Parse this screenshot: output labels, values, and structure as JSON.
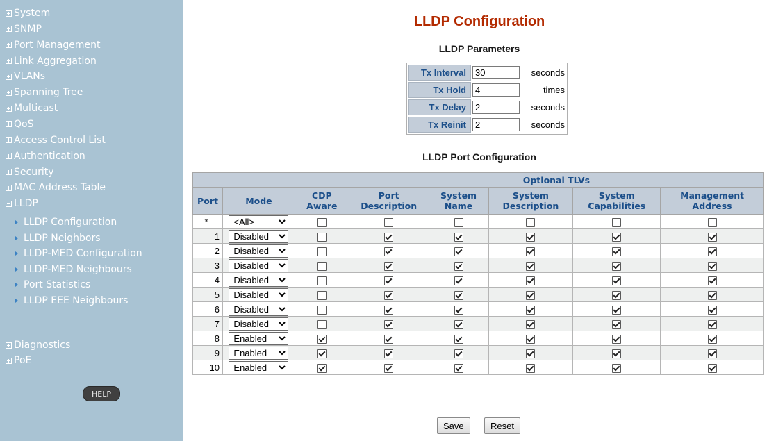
{
  "sidebar": {
    "items": [
      {
        "label": "System",
        "expand": "plus"
      },
      {
        "label": "SNMP",
        "expand": "plus"
      },
      {
        "label": "Port Management",
        "expand": "plus"
      },
      {
        "label": "Link Aggregation",
        "expand": "plus"
      },
      {
        "label": "VLANs",
        "expand": "plus"
      },
      {
        "label": "Spanning Tree",
        "expand": "plus"
      },
      {
        "label": "Multicast",
        "expand": "plus"
      },
      {
        "label": "QoS",
        "expand": "plus"
      },
      {
        "label": "Access Control List",
        "expand": "plus"
      },
      {
        "label": "Authentication",
        "expand": "plus"
      },
      {
        "label": "Security",
        "expand": "plus"
      },
      {
        "label": "MAC Address Table",
        "expand": "plus"
      },
      {
        "label": "LLDP",
        "expand": "minus"
      }
    ],
    "lldp_subitems": [
      "LLDP Configuration",
      "LLDP Neighbors",
      "LLDP-MED Configuration",
      "LLDP-MED Neighbours",
      "Port Statistics",
      "LLDP EEE Neighbours"
    ],
    "bottom_items": [
      {
        "label": "Diagnostics",
        "expand": "plus"
      },
      {
        "label": "PoE",
        "expand": "plus"
      }
    ],
    "help_label": "HELP"
  },
  "main": {
    "title": "LLDP Configuration",
    "params_title": "LLDP Parameters",
    "params": [
      {
        "label": "Tx Interval",
        "value": "30",
        "unit": "seconds"
      },
      {
        "label": "Tx Hold",
        "value": "4",
        "unit": "times"
      },
      {
        "label": "Tx Delay",
        "value": "2",
        "unit": "seconds"
      },
      {
        "label": "Tx Reinit",
        "value": "2",
        "unit": "seconds"
      }
    ],
    "port_config_title": "LLDP Port Configuration",
    "table": {
      "group_header": "Optional TLVs",
      "columns": {
        "port": "Port",
        "mode": "Mode",
        "cdp_aware": "CDP Aware",
        "port_description": "Port Description",
        "system_name": "System Name",
        "system_description": "System Description",
        "system_capabilities": "System Capabilities",
        "management_address": "Management Address"
      },
      "rows": [
        {
          "port": "*",
          "mode": "<All>",
          "cdp": false,
          "tlvs": [
            false,
            false,
            false,
            false,
            false
          ]
        },
        {
          "port": "1",
          "mode": "Disabled",
          "cdp": false,
          "tlvs": [
            true,
            true,
            true,
            true,
            true
          ]
        },
        {
          "port": "2",
          "mode": "Disabled",
          "cdp": false,
          "tlvs": [
            true,
            true,
            true,
            true,
            true
          ]
        },
        {
          "port": "3",
          "mode": "Disabled",
          "cdp": false,
          "tlvs": [
            true,
            true,
            true,
            true,
            true
          ]
        },
        {
          "port": "4",
          "mode": "Disabled",
          "cdp": false,
          "tlvs": [
            true,
            true,
            true,
            true,
            true
          ]
        },
        {
          "port": "5",
          "mode": "Disabled",
          "cdp": false,
          "tlvs": [
            true,
            true,
            true,
            true,
            true
          ]
        },
        {
          "port": "6",
          "mode": "Disabled",
          "cdp": false,
          "tlvs": [
            true,
            true,
            true,
            true,
            true
          ]
        },
        {
          "port": "7",
          "mode": "Disabled",
          "cdp": false,
          "tlvs": [
            true,
            true,
            true,
            true,
            true
          ]
        },
        {
          "port": "8",
          "mode": "Enabled",
          "cdp": true,
          "tlvs": [
            true,
            true,
            true,
            true,
            true
          ]
        },
        {
          "port": "9",
          "mode": "Enabled",
          "cdp": true,
          "tlvs": [
            true,
            true,
            true,
            true,
            true
          ]
        },
        {
          "port": "10",
          "mode": "Enabled",
          "cdp": true,
          "tlvs": [
            true,
            true,
            true,
            true,
            true
          ]
        }
      ]
    },
    "save_label": "Save",
    "reset_label": "Reset"
  }
}
